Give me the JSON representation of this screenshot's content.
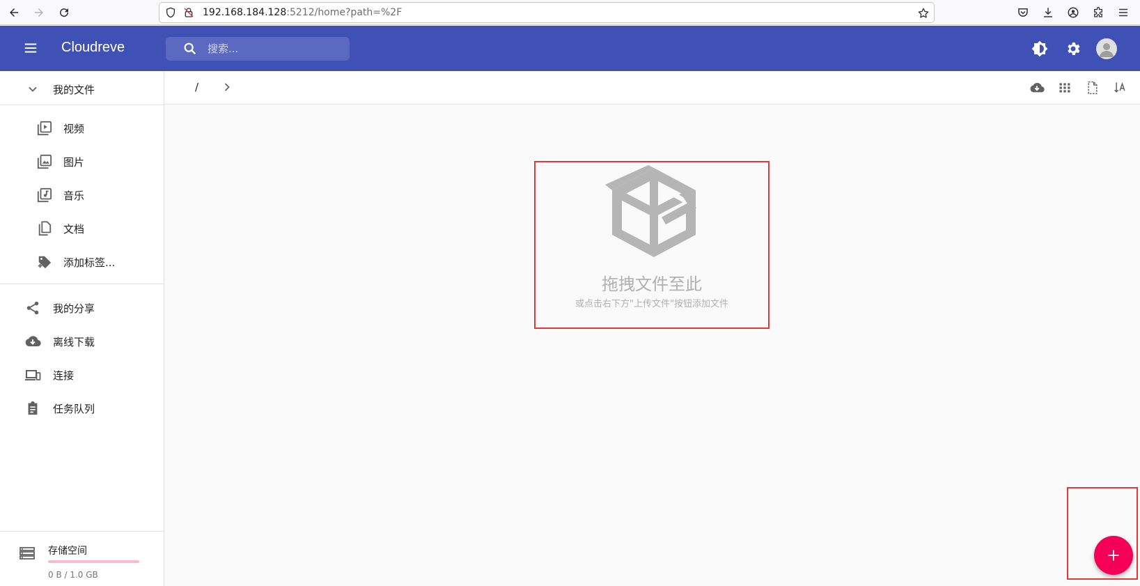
{
  "browser": {
    "url_host": "192.168.184.128",
    "url_path": ":5212/home?path=%2F"
  },
  "app": {
    "title": "Cloudreve",
    "search_placeholder": "搜索...",
    "primary_color": "#3f51b5",
    "accent_color": "#f50057"
  },
  "sidebar": {
    "my_files": "我的文件",
    "categories": [
      {
        "label": "视频",
        "icon": "video-library-icon"
      },
      {
        "label": "图片",
        "icon": "photo-library-icon"
      },
      {
        "label": "音乐",
        "icon": "music-library-icon"
      },
      {
        "label": "文档",
        "icon": "document-icon"
      },
      {
        "label": "添加标签...",
        "icon": "tag-add-icon"
      }
    ],
    "items": [
      {
        "label": "我的分享",
        "icon": "share-icon"
      },
      {
        "label": "离线下载",
        "icon": "cloud-download-icon"
      },
      {
        "label": "连接",
        "icon": "devices-icon"
      },
      {
        "label": "任务队列",
        "icon": "clipboard-icon"
      }
    ],
    "storage": {
      "label": "存储空间",
      "usage_text": "0 B / 1.0 GB",
      "used_fraction": 0.0
    }
  },
  "toolbar": {
    "breadcrumb_root": "/"
  },
  "empty_state": {
    "title": "拖拽文件至此",
    "subtitle": "或点击右下方\"上传文件\"按钮添加文件"
  },
  "fab": {
    "icon": "plus-icon"
  }
}
